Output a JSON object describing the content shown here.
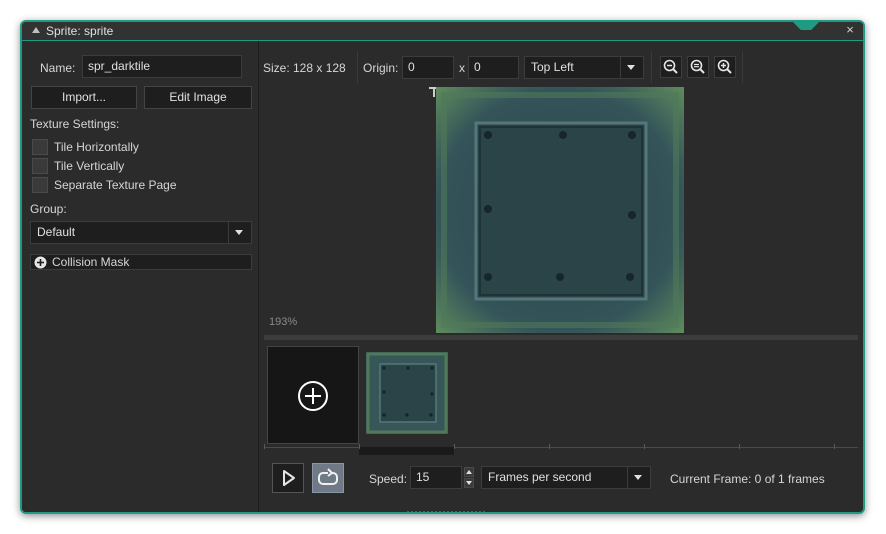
{
  "window": {
    "title": "Sprite: sprite",
    "close_glyph": "×"
  },
  "left": {
    "name_label": "Name:",
    "name_value": "spr_darktile",
    "import_label": "Import...",
    "edit_label": "Edit Image",
    "texture_settings_label": "Texture Settings:",
    "checkboxes": [
      {
        "label": "Tile Horizontally",
        "checked": false
      },
      {
        "label": "Tile Vertically",
        "checked": false
      },
      {
        "label": "Separate Texture Page",
        "checked": false
      }
    ],
    "group_label": "Group:",
    "group_value": "Default",
    "collision_label": "Collision Mask",
    "collision_icon": "plus-circle-icon"
  },
  "toolbar": {
    "size_text": "Size: 128 x 128",
    "origin_label": "Origin:",
    "origin_x": "0",
    "origin_sep": "x",
    "origin_y": "0",
    "origin_preset": "Top Left",
    "zoom_icons": [
      "zoom-out-icon",
      "zoom-reset-icon",
      "zoom-in-icon"
    ]
  },
  "preview": {
    "zoom_text": "193%"
  },
  "frames": {
    "add_icon": "add-frame-icon"
  },
  "playback": {
    "speed_label": "Speed:",
    "speed_value": "15",
    "speed_unit": "Frames per second",
    "current_frame_text": "Current Frame: 0 of 1 frames"
  },
  "colors": {
    "accent": "#1f9a83",
    "tile_base": "#2f4a4e",
    "tile_edge": "#5b8a5a"
  }
}
